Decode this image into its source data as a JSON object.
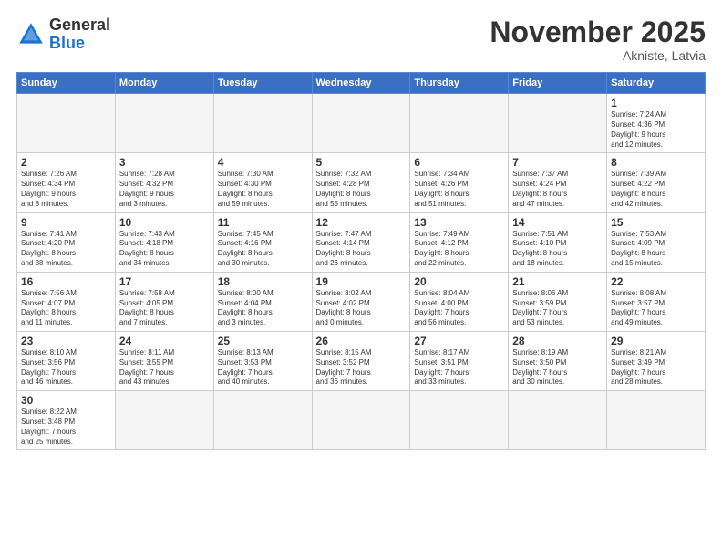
{
  "logo": {
    "general": "General",
    "blue": "Blue"
  },
  "title": "November 2025",
  "location": "Akniste, Latvia",
  "weekdays": [
    "Sunday",
    "Monday",
    "Tuesday",
    "Wednesday",
    "Thursday",
    "Friday",
    "Saturday"
  ],
  "days": [
    {
      "num": "",
      "info": ""
    },
    {
      "num": "",
      "info": ""
    },
    {
      "num": "",
      "info": ""
    },
    {
      "num": "",
      "info": ""
    },
    {
      "num": "",
      "info": ""
    },
    {
      "num": "",
      "info": ""
    },
    {
      "num": "1",
      "info": "Sunrise: 7:24 AM\nSunset: 4:36 PM\nDaylight: 9 hours\nand 12 minutes."
    },
    {
      "num": "2",
      "info": "Sunrise: 7:26 AM\nSunset: 4:34 PM\nDaylight: 9 hours\nand 8 minutes."
    },
    {
      "num": "3",
      "info": "Sunrise: 7:28 AM\nSunset: 4:32 PM\nDaylight: 9 hours\nand 3 minutes."
    },
    {
      "num": "4",
      "info": "Sunrise: 7:30 AM\nSunset: 4:30 PM\nDaylight: 8 hours\nand 59 minutes."
    },
    {
      "num": "5",
      "info": "Sunrise: 7:32 AM\nSunset: 4:28 PM\nDaylight: 8 hours\nand 55 minutes."
    },
    {
      "num": "6",
      "info": "Sunrise: 7:34 AM\nSunset: 4:26 PM\nDaylight: 8 hours\nand 51 minutes."
    },
    {
      "num": "7",
      "info": "Sunrise: 7:37 AM\nSunset: 4:24 PM\nDaylight: 8 hours\nand 47 minutes."
    },
    {
      "num": "8",
      "info": "Sunrise: 7:39 AM\nSunset: 4:22 PM\nDaylight: 8 hours\nand 42 minutes."
    },
    {
      "num": "9",
      "info": "Sunrise: 7:41 AM\nSunset: 4:20 PM\nDaylight: 8 hours\nand 38 minutes."
    },
    {
      "num": "10",
      "info": "Sunrise: 7:43 AM\nSunset: 4:18 PM\nDaylight: 8 hours\nand 34 minutes."
    },
    {
      "num": "11",
      "info": "Sunrise: 7:45 AM\nSunset: 4:16 PM\nDaylight: 8 hours\nand 30 minutes."
    },
    {
      "num": "12",
      "info": "Sunrise: 7:47 AM\nSunset: 4:14 PM\nDaylight: 8 hours\nand 26 minutes."
    },
    {
      "num": "13",
      "info": "Sunrise: 7:49 AM\nSunset: 4:12 PM\nDaylight: 8 hours\nand 22 minutes."
    },
    {
      "num": "14",
      "info": "Sunrise: 7:51 AM\nSunset: 4:10 PM\nDaylight: 8 hours\nand 18 minutes."
    },
    {
      "num": "15",
      "info": "Sunrise: 7:53 AM\nSunset: 4:09 PM\nDaylight: 8 hours\nand 15 minutes."
    },
    {
      "num": "16",
      "info": "Sunrise: 7:56 AM\nSunset: 4:07 PM\nDaylight: 8 hours\nand 11 minutes."
    },
    {
      "num": "17",
      "info": "Sunrise: 7:58 AM\nSunset: 4:05 PM\nDaylight: 8 hours\nand 7 minutes."
    },
    {
      "num": "18",
      "info": "Sunrise: 8:00 AM\nSunset: 4:04 PM\nDaylight: 8 hours\nand 3 minutes."
    },
    {
      "num": "19",
      "info": "Sunrise: 8:02 AM\nSunset: 4:02 PM\nDaylight: 8 hours\nand 0 minutes."
    },
    {
      "num": "20",
      "info": "Sunrise: 8:04 AM\nSunset: 4:00 PM\nDaylight: 7 hours\nand 56 minutes."
    },
    {
      "num": "21",
      "info": "Sunrise: 8:06 AM\nSunset: 3:59 PM\nDaylight: 7 hours\nand 53 minutes."
    },
    {
      "num": "22",
      "info": "Sunrise: 8:08 AM\nSunset: 3:57 PM\nDaylight: 7 hours\nand 49 minutes."
    },
    {
      "num": "23",
      "info": "Sunrise: 8:10 AM\nSunset: 3:56 PM\nDaylight: 7 hours\nand 46 minutes."
    },
    {
      "num": "24",
      "info": "Sunrise: 8:11 AM\nSunset: 3:55 PM\nDaylight: 7 hours\nand 43 minutes."
    },
    {
      "num": "25",
      "info": "Sunrise: 8:13 AM\nSunset: 3:53 PM\nDaylight: 7 hours\nand 40 minutes."
    },
    {
      "num": "26",
      "info": "Sunrise: 8:15 AM\nSunset: 3:52 PM\nDaylight: 7 hours\nand 36 minutes."
    },
    {
      "num": "27",
      "info": "Sunrise: 8:17 AM\nSunset: 3:51 PM\nDaylight: 7 hours\nand 33 minutes."
    },
    {
      "num": "28",
      "info": "Sunrise: 8:19 AM\nSunset: 3:50 PM\nDaylight: 7 hours\nand 30 minutes."
    },
    {
      "num": "29",
      "info": "Sunrise: 8:21 AM\nSunset: 3:49 PM\nDaylight: 7 hours\nand 28 minutes."
    },
    {
      "num": "30",
      "info": "Sunrise: 8:22 AM\nSunset: 3:48 PM\nDaylight: 7 hours\nand 25 minutes."
    },
    {
      "num": "",
      "info": ""
    },
    {
      "num": "",
      "info": ""
    },
    {
      "num": "",
      "info": ""
    },
    {
      "num": "",
      "info": ""
    },
    {
      "num": "",
      "info": ""
    },
    {
      "num": "",
      "info": ""
    }
  ]
}
